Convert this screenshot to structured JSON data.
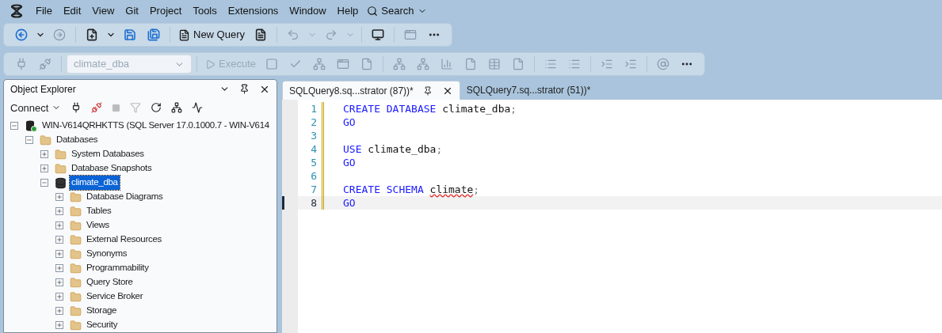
{
  "menu": [
    "File",
    "Edit",
    "View",
    "Git",
    "Project",
    "Tools",
    "Extensions",
    "Window",
    "Help"
  ],
  "search": {
    "label": "Search"
  },
  "toolbar_main": [
    {
      "kind": "back",
      "disabled": false
    },
    {
      "kind": "dropdown",
      "disabled": false
    },
    {
      "kind": "forward",
      "disabled": true
    },
    {
      "kind": "separator"
    },
    {
      "kind": "new-file",
      "disabled": false
    },
    {
      "kind": "dropdown",
      "disabled": false
    },
    {
      "kind": "save",
      "disabled": false
    },
    {
      "kind": "save-all",
      "disabled": false
    },
    {
      "kind": "separator"
    },
    {
      "kind": "text-button",
      "label": "New Query",
      "disabled": false
    },
    {
      "kind": "query-file",
      "disabled": false
    },
    {
      "kind": "separator"
    },
    {
      "kind": "undo",
      "disabled": true
    },
    {
      "kind": "dropdown",
      "disabled": true
    },
    {
      "kind": "redo",
      "disabled": true
    },
    {
      "kind": "dropdown",
      "disabled": true
    },
    {
      "kind": "separator"
    },
    {
      "kind": "monitor",
      "disabled": false
    },
    {
      "kind": "separator"
    },
    {
      "kind": "window",
      "disabled": true
    },
    {
      "kind": "more",
      "disabled": false
    }
  ],
  "toolbar_query": [
    {
      "kind": "connect",
      "disabled": true
    },
    {
      "kind": "disconnect",
      "disabled": true
    },
    {
      "kind": "separator"
    },
    {
      "kind": "database-select",
      "label": "climate_dba",
      "disabled": true
    },
    {
      "kind": "separator"
    },
    {
      "kind": "execute",
      "label": "Execute",
      "disabled": true
    },
    {
      "kind": "stop",
      "disabled": true
    },
    {
      "kind": "parse",
      "disabled": true
    },
    {
      "kind": "plan",
      "disabled": true
    },
    {
      "kind": "window",
      "disabled": true
    },
    {
      "kind": "file",
      "disabled": true
    },
    {
      "kind": "separator"
    },
    {
      "kind": "plan",
      "disabled": true
    },
    {
      "kind": "plan",
      "disabled": true
    },
    {
      "kind": "chart",
      "disabled": true
    },
    {
      "kind": "file",
      "disabled": true
    },
    {
      "kind": "grid",
      "disabled": true
    },
    {
      "kind": "file",
      "disabled": true
    },
    {
      "kind": "separator"
    },
    {
      "kind": "list",
      "disabled": true
    },
    {
      "kind": "list",
      "disabled": true
    },
    {
      "kind": "separator"
    },
    {
      "kind": "indent",
      "disabled": true
    },
    {
      "kind": "indent",
      "disabled": true
    },
    {
      "kind": "separator"
    },
    {
      "kind": "mail",
      "disabled": true
    },
    {
      "kind": "more",
      "disabled": false
    }
  ],
  "object_explorer": {
    "title": "Object Explorer",
    "connect": "Connect",
    "tree": [
      {
        "label": "WIN-V614QRHKTTS (SQL Server 17.0.1000.7 - WIN-V614",
        "kind": "server",
        "expanded": true,
        "selected": false,
        "children": [
          {
            "label": "Databases",
            "kind": "folder",
            "expanded": true,
            "selected": false,
            "children": [
              {
                "label": "System Databases",
                "kind": "folder",
                "expanded": false,
                "selected": false
              },
              {
                "label": "Database Snapshots",
                "kind": "folder",
                "expanded": false,
                "selected": false
              },
              {
                "label": "climate_dba",
                "kind": "database",
                "expanded": true,
                "selected": true,
                "children": [
                  {
                    "label": "Database Diagrams",
                    "kind": "folder",
                    "expanded": false,
                    "selected": false
                  },
                  {
                    "label": "Tables",
                    "kind": "folder",
                    "expanded": false,
                    "selected": false
                  },
                  {
                    "label": "Views",
                    "kind": "folder",
                    "expanded": false,
                    "selected": false
                  },
                  {
                    "label": "External Resources",
                    "kind": "folder",
                    "expanded": false,
                    "selected": false
                  },
                  {
                    "label": "Synonyms",
                    "kind": "folder",
                    "expanded": false,
                    "selected": false
                  },
                  {
                    "label": "Programmability",
                    "kind": "folder",
                    "expanded": false,
                    "selected": false
                  },
                  {
                    "label": "Query Store",
                    "kind": "folder",
                    "expanded": false,
                    "selected": false
                  },
                  {
                    "label": "Service Broker",
                    "kind": "folder",
                    "expanded": false,
                    "selected": false
                  },
                  {
                    "label": "Storage",
                    "kind": "folder",
                    "expanded": false,
                    "selected": false
                  },
                  {
                    "label": "Security",
                    "kind": "folder",
                    "expanded": false,
                    "selected": false
                  }
                ]
              }
            ]
          }
        ]
      }
    ]
  },
  "tabs": [
    {
      "label": "SQLQuery8.sq...strator (87))*",
      "selected": true
    },
    {
      "label": "SQLQuery7.sq...strator (51))*",
      "selected": false
    }
  ],
  "editor": {
    "lines": [
      {
        "number": "1",
        "current": false,
        "tokens": [
          {
            "kind": "keyword",
            "text": "CREATE DATABASE"
          },
          {
            "kind": "plain",
            "text": " climate_dba"
          },
          {
            "kind": "punct",
            "text": ";"
          }
        ]
      },
      {
        "number": "2",
        "current": false,
        "tokens": [
          {
            "kind": "keyword",
            "text": "GO"
          }
        ]
      },
      {
        "number": "3",
        "current": false
      },
      {
        "number": "4",
        "current": false,
        "tokens": [
          {
            "kind": "keyword",
            "text": "USE"
          },
          {
            "kind": "plain",
            "text": " climate_dba"
          },
          {
            "kind": "punct",
            "text": ";"
          }
        ]
      },
      {
        "number": "5",
        "current": false,
        "tokens": [
          {
            "kind": "keyword",
            "text": "GO"
          }
        ]
      },
      {
        "number": "6",
        "current": false
      },
      {
        "number": "7",
        "current": false,
        "tokens": [
          {
            "kind": "keyword",
            "text": "CREATE SCHEMA"
          },
          {
            "kind": "error",
            "text": "climate"
          },
          {
            "kind": "punct",
            "text": ";"
          }
        ]
      },
      {
        "number": "8",
        "current": true,
        "tokens": [
          {
            "kind": "keyword",
            "text": "GO"
          }
        ]
      }
    ]
  }
}
